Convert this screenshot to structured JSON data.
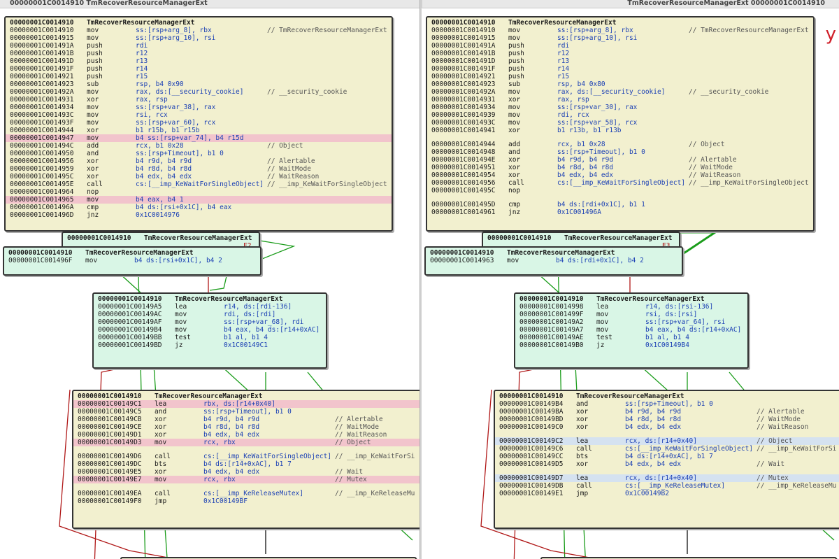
{
  "window": {
    "left_title": "00000001C0014910 TmRecoverResourceManagerExt",
    "right_title": "TmRecoverResourceManagerExt 00000001C0014910"
  },
  "left": {
    "main_block": {
      "rows": [
        {
          "a": "00000001C0014910",
          "m": "TmRecoverResourceManagerExt",
          "o": "",
          "c": ""
        },
        {
          "a": "00000001C0014910",
          "m": "mov",
          "o": "ss:[rsp+arg_8], rbx",
          "c": "// TmRecoverResourceManagerExt"
        },
        {
          "a": "00000001C0014915",
          "m": "mov",
          "o": "ss:[rsp+arg_10], rsi",
          "c": ""
        },
        {
          "a": "00000001C001491A",
          "m": "push",
          "o": "rdi",
          "c": ""
        },
        {
          "a": "00000001C001491B",
          "m": "push",
          "o": "r12",
          "c": ""
        },
        {
          "a": "00000001C001491D",
          "m": "push",
          "o": "r13",
          "c": ""
        },
        {
          "a": "00000001C001491F",
          "m": "push",
          "o": "r14",
          "c": ""
        },
        {
          "a": "00000001C0014921",
          "m": "push",
          "o": "r15",
          "c": ""
        },
        {
          "a": "00000001C0014923",
          "m": "sub",
          "o": "rsp, b4 0x90",
          "c": ""
        },
        {
          "a": "00000001C001492A",
          "m": "mov",
          "o": "rax, ds:[__security_cookie]",
          "c": "// __security_cookie"
        },
        {
          "a": "00000001C0014931",
          "m": "xor",
          "o": "rax, rsp",
          "c": ""
        },
        {
          "a": "00000001C0014934",
          "m": "mov",
          "o": "ss:[rsp+var_38], rax",
          "c": ""
        },
        {
          "a": "00000001C001493C",
          "m": "mov",
          "o": "rsi, rcx",
          "c": ""
        },
        {
          "a": "00000001C001493F",
          "m": "mov",
          "o": "ss:[rsp+var_60], rcx",
          "c": ""
        },
        {
          "a": "00000001C0014944",
          "m": "xor",
          "o": "b1 r15b, b1 r15b",
          "c": ""
        },
        {
          "a": "00000001C0014947",
          "m": "mov",
          "o": "b4 ss:[rsp+var_74], b4 r15d",
          "c": "",
          "hl": "hl"
        },
        {
          "a": "00000001C001494C",
          "m": "add",
          "o": "rcx, b1 0x28",
          "c": "// Object"
        },
        {
          "a": "00000001C0014950",
          "m": "and",
          "o": "ss:[rsp+Timeout], b1 0",
          "c": ""
        },
        {
          "a": "00000001C0014956",
          "m": "xor",
          "o": "b4 r9d, b4 r9d",
          "c": "// Alertable"
        },
        {
          "a": "00000001C0014959",
          "m": "xor",
          "o": "b4 r8d, b4 r8d",
          "c": "// WaitMode"
        },
        {
          "a": "00000001C001495C",
          "m": "xor",
          "o": "b4 edx, b4 edx",
          "c": "// WaitReason"
        },
        {
          "a": "00000001C001495E",
          "m": "call",
          "o": "cs:[__imp_KeWaitForSingleObject]",
          "c": "// __imp_KeWaitForSingleObject"
        },
        {
          "a": "00000001C0014964",
          "m": "nop",
          "o": "",
          "c": ""
        },
        {
          "a": "00000001C0014965",
          "m": "mov",
          "o": "b4 eax, b4 1",
          "c": "",
          "hl": "hl"
        },
        {
          "a": "00000001C001496A",
          "m": "cmp",
          "o": "b4 ds:[rsi+0x1C], b4 eax",
          "c": ""
        },
        {
          "a": "00000001C001496D",
          "m": "jnz",
          "o": "0x1C0014976",
          "c": ""
        }
      ]
    },
    "small_back": {
      "a": "00000001C0014910",
      "t": "TmRecoverResourceManagerExt",
      "tail": "F2"
    },
    "small_front": {
      "a": "00000001C0014910",
      "t": "TmRecoverResourceManagerExt",
      "row": {
        "a": "00000001C001496F",
        "m": "mov",
        "o": "b4 ds:[rsi+0x1C], b4 2"
      }
    },
    "mid_block": {
      "rows": [
        {
          "a": "00000001C0014910",
          "m": "TmRecoverResourceManagerExt",
          "o": "",
          "c": ""
        },
        {
          "a": "00000001C00149A5",
          "m": "lea",
          "o": "r14, ds:[rdi-136]",
          "c": ""
        },
        {
          "a": "00000001C00149AC",
          "m": "mov",
          "o": "rdi, ds:[rdi]",
          "c": ""
        },
        {
          "a": "00000001C00149AF",
          "m": "mov",
          "o": "ss:[rsp+var_68], rdi",
          "c": ""
        },
        {
          "a": "00000001C00149B4",
          "m": "mov",
          "o": "b4 eax, b4 ds:[r14+0xAC]",
          "c": ""
        },
        {
          "a": "00000001C00149BB",
          "m": "test",
          "o": "b1 al, b1 4",
          "c": ""
        },
        {
          "a": "00000001C00149BD",
          "m": "jz",
          "o": "0x1C00149C1",
          "c": ""
        }
      ]
    },
    "bottom_block": {
      "rows": [
        {
          "a": "00000001C0014910",
          "m": "TmRecoverResourceManagerExt",
          "o": "",
          "c": ""
        },
        {
          "a": "00000001C00149C1",
          "m": "lea",
          "o": "rbx, ds:[r14+0x40]",
          "c": "",
          "hl": "hl"
        },
        {
          "a": "00000001C00149C5",
          "m": "and",
          "o": "ss:[rsp+Timeout], b1 0",
          "c": ""
        },
        {
          "a": "00000001C00149CB",
          "m": "xor",
          "o": "b4 r9d, b4 r9d",
          "c": "// Alertable"
        },
        {
          "a": "00000001C00149CE",
          "m": "xor",
          "o": "b4 r8d, b4 r8d",
          "c": "// WaitMode"
        },
        {
          "a": "00000001C00149D1",
          "m": "xor",
          "o": "b4 edx, b4 edx",
          "c": "// WaitReason"
        },
        {
          "a": "00000001C00149D3",
          "m": "mov",
          "o": "rcx, rbx",
          "c": "// Object",
          "hl": "hl"
        },
        {
          "blank": true
        },
        {
          "a": "00000001C00149D6",
          "m": "call",
          "o": "cs:[__imp_KeWaitForSingleObject]",
          "c": "// __imp_KeWaitForSi"
        },
        {
          "a": "00000001C00149DC",
          "m": "bts",
          "o": "b4 ds:[r14+0xAC], b1 7",
          "c": ""
        },
        {
          "a": "00000001C00149E5",
          "m": "xor",
          "o": "b4 edx, b4 edx",
          "c": "// Wait"
        },
        {
          "a": "00000001C00149E7",
          "m": "mov",
          "o": "rcx, rbx",
          "c": "// Mutex",
          "hl": "hl"
        },
        {
          "blank": true
        },
        {
          "a": "00000001C00149EA",
          "m": "call",
          "o": "cs:[__imp_KeReleaseMutex]",
          "c": "// __imp_KeReleaseMu"
        },
        {
          "a": "00000001C00149F0",
          "m": "jmp",
          "o": "0x1C00149BF",
          "c": ""
        }
      ]
    }
  },
  "right": {
    "main_block": {
      "rows": [
        {
          "a": "00000001C0014910",
          "m": "TmRecoverResourceManagerExt",
          "o": "",
          "c": ""
        },
        {
          "a": "00000001C0014910",
          "m": "mov",
          "o": "ss:[rsp+arg_8], rbx",
          "c": "// TmRecoverResourceManagerExt"
        },
        {
          "a": "00000001C0014915",
          "m": "mov",
          "o": "ss:[rsp+arg_10], rsi",
          "c": ""
        },
        {
          "a": "00000001C001491A",
          "m": "push",
          "o": "rdi",
          "c": ""
        },
        {
          "a": "00000001C001491B",
          "m": "push",
          "o": "r12",
          "c": ""
        },
        {
          "a": "00000001C001491D",
          "m": "push",
          "o": "r13",
          "c": ""
        },
        {
          "a": "00000001C001491F",
          "m": "push",
          "o": "r14",
          "c": ""
        },
        {
          "a": "00000001C0014921",
          "m": "push",
          "o": "r15",
          "c": ""
        },
        {
          "a": "00000001C0014923",
          "m": "sub",
          "o": "rsp, b4 0x80",
          "c": ""
        },
        {
          "a": "00000001C001492A",
          "m": "mov",
          "o": "rax, ds:[__security_cookie]",
          "c": "// __security_cookie"
        },
        {
          "a": "00000001C0014931",
          "m": "xor",
          "o": "rax, rsp",
          "c": ""
        },
        {
          "a": "00000001C0014934",
          "m": "mov",
          "o": "ss:[rsp+var_30], rax",
          "c": ""
        },
        {
          "a": "00000001C0014939",
          "m": "mov",
          "o": "rdi, rcx",
          "c": ""
        },
        {
          "a": "00000001C001493C",
          "m": "mov",
          "o": "ss:[rsp+var_58], rcx",
          "c": ""
        },
        {
          "a": "00000001C0014941",
          "m": "xor",
          "o": "b1 r13b, b1 r13b",
          "c": ""
        },
        {
          "blank": true
        },
        {
          "a": "00000001C0014944",
          "m": "add",
          "o": "rcx, b1 0x28",
          "c": "// Object"
        },
        {
          "a": "00000001C0014948",
          "m": "and",
          "o": "ss:[rsp+Timeout], b1 0",
          "c": ""
        },
        {
          "a": "00000001C001494E",
          "m": "xor",
          "o": "b4 r9d, b4 r9d",
          "c": "// Alertable"
        },
        {
          "a": "00000001C0014951",
          "m": "xor",
          "o": "b4 r8d, b4 r8d",
          "c": "// WaitMode"
        },
        {
          "a": "00000001C0014954",
          "m": "xor",
          "o": "b4 edx, b4 edx",
          "c": "// WaitReason"
        },
        {
          "a": "00000001C0014956",
          "m": "call",
          "o": "cs:[__imp_KeWaitForSingleObject]",
          "c": "// __imp_KeWaitForSingleObject"
        },
        {
          "a": "00000001C001495C",
          "m": "nop",
          "o": "",
          "c": ""
        },
        {
          "blank": true
        },
        {
          "a": "00000001C001495D",
          "m": "cmp",
          "o": "b4 ds:[rdi+0x1C], b1 1",
          "c": ""
        },
        {
          "a": "00000001C0014961",
          "m": "jnz",
          "o": "0x1C001496A",
          "c": ""
        }
      ]
    },
    "small_back": {
      "a": "00000001C0014910",
      "t": "TmRecoverResourceManagerExt",
      "tail": "E3"
    },
    "small_front": {
      "a": "00000001C0014910",
      "t": "TmRecoverResourceManagerExt",
      "row": {
        "a": "00000001C0014963",
        "m": "mov",
        "o": "b4 ds:[rdi+0x1C], b4 2"
      }
    },
    "mid_block": {
      "rows": [
        {
          "a": "00000001C0014910",
          "m": "TmRecoverResourceManagerExt",
          "o": "",
          "c": ""
        },
        {
          "a": "00000001C0014998",
          "m": "lea",
          "o": "r14, ds:[rsi-136]",
          "c": ""
        },
        {
          "a": "00000001C001499F",
          "m": "mov",
          "o": "rsi, ds:[rsi]",
          "c": ""
        },
        {
          "a": "00000001C00149A2",
          "m": "mov",
          "o": "ss:[rsp+var_64], rsi",
          "c": ""
        },
        {
          "a": "00000001C00149A7",
          "m": "mov",
          "o": "b4 eax, b4 ds:[r14+0xAC]",
          "c": ""
        },
        {
          "a": "00000001C00149AE",
          "m": "test",
          "o": "b1 al, b1 4",
          "c": ""
        },
        {
          "a": "00000001C00149B0",
          "m": "jz",
          "o": "0x1C00149B4",
          "c": ""
        }
      ]
    },
    "bottom_block": {
      "rows": [
        {
          "a": "00000001C0014910",
          "m": "TmRecoverResourceManagerExt",
          "o": "",
          "c": ""
        },
        {
          "a": "00000001C00149B4",
          "m": "and",
          "o": "ss:[rsp+Timeout], b1 0",
          "c": ""
        },
        {
          "a": "00000001C00149BA",
          "m": "xor",
          "o": "b4 r9d, b4 r9d",
          "c": "// Alertable"
        },
        {
          "a": "00000001C00149BD",
          "m": "xor",
          "o": "b4 r8d, b4 r8d",
          "c": "// WaitMode"
        },
        {
          "a": "00000001C00149C0",
          "m": "xor",
          "o": "b4 edx, b4 edx",
          "c": "// WaitReason"
        },
        {
          "blank": true
        },
        {
          "a": "00000001C00149C2",
          "m": "lea",
          "o": "rcx, ds:[r14+0x40]",
          "c": "// Object",
          "hl": "hlb"
        },
        {
          "a": "00000001C00149C6",
          "m": "call",
          "o": "cs:[__imp_KeWaitForSingleObject]",
          "c": "// __imp_KeWaitForSi"
        },
        {
          "a": "00000001C00149CC",
          "m": "bts",
          "o": "b4 ds:[r14+0xAC], b1 7",
          "c": ""
        },
        {
          "a": "00000001C00149D5",
          "m": "xor",
          "o": "b4 edx, b4 edx",
          "c": "// Wait"
        },
        {
          "blank": true
        },
        {
          "a": "00000001C00149D7",
          "m": "lea",
          "o": "rcx, ds:[r14+0x40]",
          "c": "// Mutex",
          "hl": "hlb"
        },
        {
          "a": "00000001C00149DB",
          "m": "call",
          "o": "cs:[__imp_KeReleaseMutex]",
          "c": "// __imp_KeReleaseMu"
        },
        {
          "a": "00000001C00149E1",
          "m": "jmp",
          "o": "0x1C00149B2",
          "c": ""
        }
      ]
    }
  },
  "annotation_glyph": "y",
  "colors": {
    "node_fill": "#f2f0cf",
    "node_fill_small": "#d9f6e6",
    "edge_true": "#1a9c1a",
    "edge_false": "#b01818",
    "edge_plain": "#111111",
    "row_highlight": "#f2c4cc",
    "row_highlight_blue": "#d5e2f0"
  }
}
